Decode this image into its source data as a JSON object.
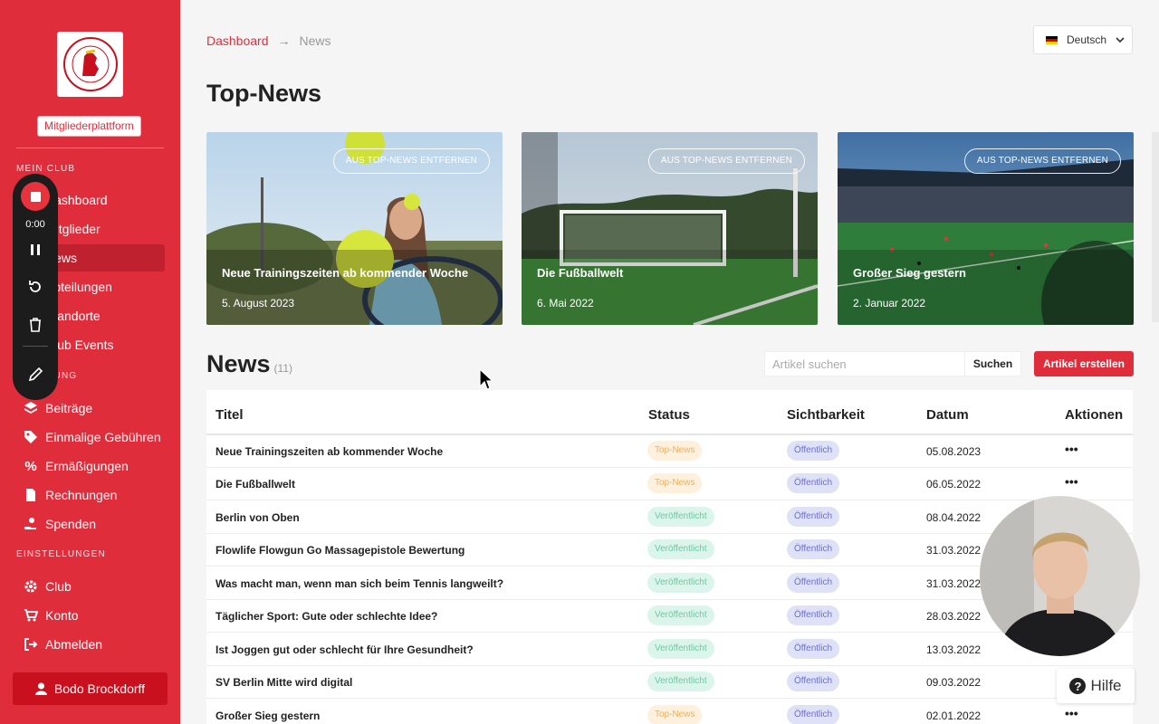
{
  "sidebar": {
    "logo_text": "SV BERLIN MITTE",
    "logo_year": "2020",
    "platform_label": "Mitgliederplattform",
    "section_my_club": "MEIN CLUB",
    "section_billing": "RECHNUNG",
    "section_settings": "EINSTELLUNGEN",
    "items": [
      {
        "label": "Dashboard",
        "icon": "home-icon"
      },
      {
        "label": "Mitglieder",
        "icon": "users-icon"
      },
      {
        "label": "News",
        "icon": "news-icon",
        "active": true
      },
      {
        "label": "Abteilungen",
        "icon": "folder-icon"
      },
      {
        "label": "Standorte",
        "icon": "location-icon"
      },
      {
        "label": "Club Events",
        "icon": "calendar-icon"
      }
    ],
    "billing_items": [
      {
        "label": "Beiträge",
        "icon": "layers-icon"
      },
      {
        "label": "Einmalige Gebühren",
        "icon": "tag-icon"
      },
      {
        "label": "Ermäßigungen",
        "icon": "percent-icon"
      },
      {
        "label": "Rechnungen",
        "icon": "invoice-icon"
      },
      {
        "label": "Spenden",
        "icon": "donate-icon"
      }
    ],
    "settings_items": [
      {
        "label": "Club",
        "icon": "gear-icon"
      },
      {
        "label": "Konto",
        "icon": "cart-icon"
      },
      {
        "label": "Abmelden",
        "icon": "logout-icon"
      }
    ],
    "user_name": "Bodo Brockdorff"
  },
  "recorder": {
    "time": "0:00"
  },
  "breadcrumb": {
    "root": "Dashboard",
    "arrow": "→",
    "current": "News"
  },
  "language": {
    "selected": "Deutsch"
  },
  "top_news": {
    "title": "Top-News",
    "remove_label": "AUS TOP-NEWS ENTFERNEN",
    "cards": [
      {
        "title": "Neue Trainingszeiten ab kommender Woche",
        "date": "5. August 2023"
      },
      {
        "title": "Die Fußballwelt",
        "date": "6. Mai 2022"
      },
      {
        "title": "Großer Sieg gestern",
        "date": "2. Januar 2022"
      }
    ]
  },
  "news": {
    "title": "News",
    "count": "(11)",
    "search_placeholder": "Artikel suchen",
    "search_button": "Suchen",
    "create_button": "Artikel erstellen",
    "columns": {
      "title": "Titel",
      "status": "Status",
      "visibility": "Sichtbarkeit",
      "date": "Datum",
      "actions": "Aktionen"
    },
    "rows": [
      {
        "title": "Neue Trainingszeiten ab kommender Woche",
        "status": "Top-News",
        "visibility": "Öffentlich",
        "date": "05.08.2023"
      },
      {
        "title": "Die Fußballwelt",
        "status": "Top-News",
        "visibility": "Öffentlich",
        "date": "06.05.2022"
      },
      {
        "title": "Berlin von Oben",
        "status": "Veröffentlicht",
        "visibility": "Öffentlich",
        "date": "08.04.2022"
      },
      {
        "title": "Flowlife Flowgun Go Massagepistole Bewertung",
        "status": "Veröffentlicht",
        "visibility": "Öffentlich",
        "date": "31.03.2022"
      },
      {
        "title": "Was macht man, wenn man sich beim Tennis langweilt?",
        "status": "Veröffentlicht",
        "visibility": "Öffentlich",
        "date": "31.03.2022"
      },
      {
        "title": "Täglicher Sport: Gute oder schlechte Idee?",
        "status": "Veröffentlicht",
        "visibility": "Öffentlich",
        "date": "28.03.2022"
      },
      {
        "title": "Ist Joggen gut oder schlecht für Ihre Gesundheit?",
        "status": "Veröffentlicht",
        "visibility": "Öffentlich",
        "date": "13.03.2022"
      },
      {
        "title": "SV Berlin Mitte wird digital",
        "status": "Veröffentlicht",
        "visibility": "Öffentlich",
        "date": "09.03.2022"
      },
      {
        "title": "Großer Sieg gestern",
        "status": "Top-News",
        "visibility": "Öffentlich",
        "date": "02.01.2022"
      }
    ],
    "actions_glyph": "•••"
  },
  "help": {
    "label": "Hilfe",
    "icon_glyph": "?"
  },
  "colors": {
    "brand": "#e02d3c",
    "top_news": "#f0b160",
    "published": "#6cc9a2",
    "visibility": "#6b71c9"
  }
}
